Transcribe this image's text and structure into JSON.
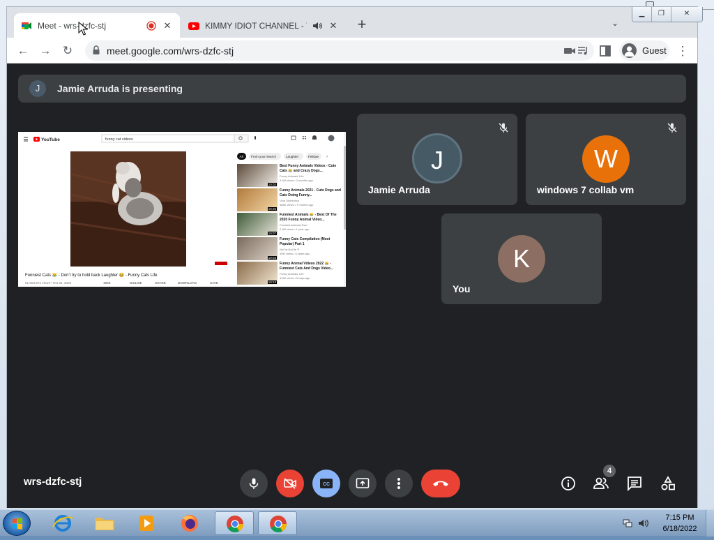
{
  "browser": {
    "tabs": [
      {
        "title": "Meet - wrs-dzfc-stj",
        "icon": "google-meet-icon",
        "recording": true,
        "active": true
      },
      {
        "title": "KIMMY IDIOT CHANNEL - Yo",
        "icon": "youtube-icon",
        "audio": true,
        "active": false
      }
    ],
    "new_tab_label": "+",
    "url": "meet.google.com/wrs-dzfc-stj",
    "profile_label": "Guest"
  },
  "meet": {
    "presenting_banner": {
      "initial": "J",
      "text": "Jamie Arruda is presenting"
    },
    "meeting_code": "wrs-dzfc-stj",
    "participants": [
      {
        "initial": "J",
        "name": "Jamie Arruda",
        "color": "#455a64",
        "muted": true
      },
      {
        "initial": "W",
        "name": "windows 7 collab vm",
        "color": "#e8710a",
        "muted": true
      },
      {
        "initial": "K",
        "name": "You",
        "color": "#8d6e63",
        "muted": false
      }
    ],
    "people_count": "4",
    "colors": {
      "background": "#202124",
      "tile": "#3c4043",
      "end_call": "#ea4335",
      "cc_active": "#8ab4f8"
    }
  },
  "shared_screen": {
    "site": "YouTube",
    "search_query": "funny cat videos",
    "chips": [
      "All",
      "From your search",
      "Laughter",
      "Felidae"
    ],
    "video_title": "Funniest Cats 😹 - Don't try to hold back Laughter 😂 - Funny Cats Life",
    "video_meta": "61,554,573 views • Oct 25, 2020",
    "actions": [
      "196K",
      "DISLIKE",
      "SHARE",
      "DOWNLOAD",
      "SAVE"
    ],
    "recommendations": [
      {
        "title": "Best Funny Animals Videos - Cute Cats 😹 and Crazy Dogs...",
        "channel": "Funny Animals' Life",
        "meta": "3.4M views • 2 months ago",
        "duration": "10:02"
      },
      {
        "title": "Funny Animals 2021 - Cute Dogs and Cats Doing Funny...",
        "channel": "Vida Doméstica",
        "meta": "388K views • 7 months ago",
        "duration": "10:25"
      },
      {
        "title": "Funniest Animals 😹 - Best Of The 2020 Funny Animal Video...",
        "channel": "Funniest Animals Ever",
        "meta": "2.9M views • 1 year ago",
        "duration": "10:07"
      },
      {
        "title": "Funny Cats Compilation (Most Popular) Part 1",
        "channel": "NoCat NoLife ®",
        "meta": "49M views • 6 years ago",
        "duration": "10:03"
      },
      {
        "title": "Funny Animal Videos 2022 😹 - Funniest Cats And Dogs Video...",
        "channel": "Funny Animals' Life",
        "meta": "415K views • 5 days ago",
        "duration": "10:13"
      }
    ]
  },
  "taskbar": {
    "time": "7:15 PM",
    "date": "6/18/2022",
    "apps": [
      "internet-explorer-icon",
      "file-explorer-icon",
      "media-player-icon",
      "firefox-icon",
      "chrome-icon",
      "chrome-icon"
    ]
  }
}
